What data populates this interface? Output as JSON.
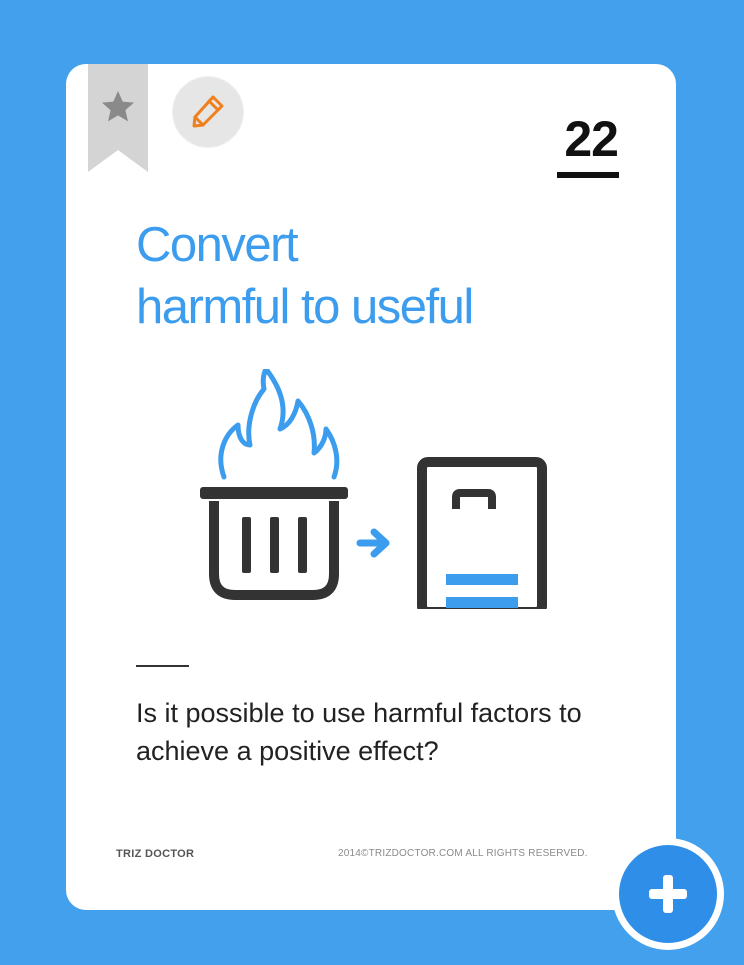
{
  "card": {
    "number": "22",
    "title_lines": [
      "Convert",
      "harmful to useful"
    ],
    "question": "Is it possible to use harmful factors to achieve a positive effect?",
    "brand": "TRIZ DOCTOR",
    "copyright": "2014©TRIZDOCTOR.COM  ALL RIGHTS RESERVED."
  },
  "icons": {
    "bookmark": "bookmark-star-icon",
    "edit": "pencil-icon",
    "illustration": [
      "burning-trash-bin-icon",
      "arrow-right-icon",
      "battery-icon"
    ],
    "add": "plus-icon"
  },
  "colors": {
    "background": "#42a0ec",
    "accent": "#3c9cee",
    "pencil": "#f07f1c",
    "dark": "#333333",
    "add_button": "#2f8fe8"
  }
}
